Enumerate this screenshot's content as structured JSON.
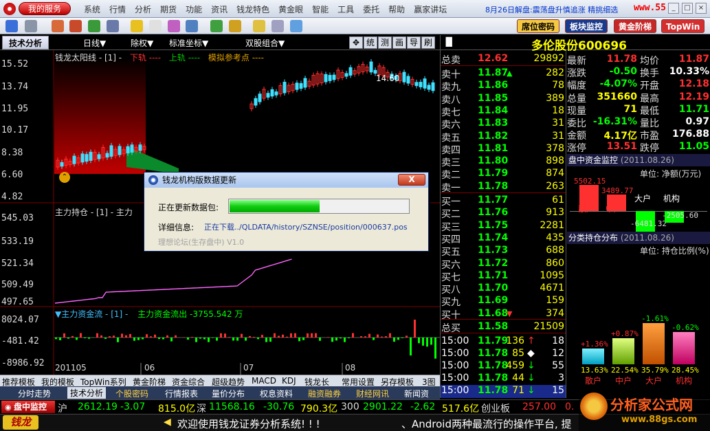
{
  "menubar": {
    "logo_label": "我的服务",
    "items": [
      "系统",
      "行情",
      "分析",
      "期货",
      "功能",
      "资讯",
      "钱龙特色",
      "黄金眼",
      "智能",
      "工具",
      "委托",
      "帮助",
      "赢家讲坛"
    ],
    "news": "8月26日解盘:震荡盘升慎追涨 精挑细选",
    "site": "www.55188.com",
    "win_min": "_",
    "win_max": "□",
    "win_close": "×"
  },
  "toolbar": {
    "buttons": [
      {
        "label": "席位密码",
        "color": "#f5c842",
        "text": "#000"
      },
      {
        "label": "板块监控",
        "color": "#1a3a8c",
        "text": "#fff"
      },
      {
        "label": "黄金阶梯",
        "color": "#c62828",
        "text": "#fff"
      },
      {
        "label": "TopWin",
        "color": "#d32f2f",
        "text": "#fff"
      }
    ]
  },
  "tabrow": {
    "tech_tab": "技术分析",
    "dropdowns": [
      "日线▼",
      "除权▼",
      "标准坐标▼",
      "双股组合▼"
    ],
    "tools": [
      "✥",
      "统",
      "测",
      "画",
      "导",
      "刷"
    ]
  },
  "chart": {
    "price_axis": [
      "15.52",
      "13.74",
      "11.95",
      "10.17",
      "8.38",
      "6.60",
      "4.82"
    ],
    "hold_axis": [
      "545.03",
      "533.19",
      "521.34",
      "509.49",
      "497.65"
    ],
    "flow_axis": [
      "8024.07",
      "-481.42",
      "-8986.92"
    ],
    "main_title": "钱龙太阳线 - [1] -",
    "legend_lower": "下轨 ----",
    "legend_upper": "上轨 ----",
    "legend_ref": "模拟参考点 ----",
    "peak_label": "14.60",
    "hold_title": "主力持仓 - [1] - 主力",
    "flow_title": "▼主力资金流 - [1] -",
    "flow_value": "主力资金流出 -3755.542 万",
    "date_labels": [
      "201105",
      "06",
      "07",
      "08"
    ]
  },
  "stock": {
    "tag": "▐▌",
    "name": "多伦股份600696"
  },
  "orderbook": {
    "sell_total": {
      "label": "总卖",
      "price": "12.62",
      "vol": "29892"
    },
    "sells": [
      {
        "label": "卖十",
        "price": "11.87",
        "vol": "282",
        "mark": "▲"
      },
      {
        "label": "卖九",
        "price": "11.86",
        "vol": "78",
        "mark": ""
      },
      {
        "label": "卖八",
        "price": "11.85",
        "vol": "389",
        "mark": ""
      },
      {
        "label": "卖七",
        "price": "11.84",
        "vol": "18",
        "mark": ""
      },
      {
        "label": "卖六",
        "price": "11.83",
        "vol": "31",
        "mark": ""
      },
      {
        "label": "卖五",
        "price": "11.82",
        "vol": "31",
        "mark": ""
      },
      {
        "label": "卖四",
        "price": "11.81",
        "vol": "378",
        "mark": ""
      },
      {
        "label": "卖三",
        "price": "11.80",
        "vol": "898",
        "mark": ""
      },
      {
        "label": "卖二",
        "price": "11.79",
        "vol": "874",
        "mark": ""
      },
      {
        "label": "卖一",
        "price": "11.78",
        "vol": "263",
        "mark": ""
      }
    ],
    "buys": [
      {
        "label": "买一",
        "price": "11.77",
        "vol": "61",
        "mark": ""
      },
      {
        "label": "买二",
        "price": "11.76",
        "vol": "913",
        "mark": ""
      },
      {
        "label": "买三",
        "price": "11.75",
        "vol": "2281",
        "mark": ""
      },
      {
        "label": "买四",
        "price": "11.74",
        "vol": "435",
        "mark": ""
      },
      {
        "label": "买五",
        "price": "11.73",
        "vol": "688",
        "mark": ""
      },
      {
        "label": "买六",
        "price": "11.72",
        "vol": "860",
        "mark": ""
      },
      {
        "label": "买七",
        "price": "11.71",
        "vol": "1095",
        "mark": ""
      },
      {
        "label": "买八",
        "price": "11.70",
        "vol": "4671",
        "mark": ""
      },
      {
        "label": "买九",
        "price": "11.69",
        "vol": "159",
        "mark": ""
      },
      {
        "label": "买十",
        "price": "11.68",
        "vol": "374",
        "mark": "▼"
      }
    ],
    "buy_total": {
      "label": "总买",
      "price": "11.58",
      "vol": "21509"
    },
    "ticks": [
      {
        "time": "15:00",
        "price": "11.79",
        "vol": "136",
        "arrow": "↑",
        "n": "18",
        "c": "#ff3030"
      },
      {
        "time": "15:00",
        "price": "11.78",
        "vol": "85",
        "arrow": "◆",
        "n": "12",
        "c": "#ffffff"
      },
      {
        "time": "15:00",
        "price": "11.78",
        "vol": "459",
        "arrow": "↓",
        "n": "55",
        "c": "#00ff00"
      },
      {
        "time": "15:00",
        "price": "11.78",
        "vol": "44",
        "arrow": "↓",
        "n": "3",
        "c": "#00ff00"
      },
      {
        "time": "15:00",
        "price": "11.78",
        "vol": "71",
        "arrow": "↓",
        "n": "15",
        "c": "#00ff00"
      }
    ]
  },
  "quote": [
    {
      "k1": "最新",
      "v1": "11.78",
      "c1": "#ff3030",
      "k2": "均价",
      "v2": "11.87",
      "c2": "#ff3030"
    },
    {
      "k1": "涨跌",
      "v1": "-0.50",
      "c1": "#00ff00",
      "k2": "换手",
      "v2": "10.33%",
      "c2": "#ffffff"
    },
    {
      "k1": "幅度",
      "v1": "-4.07%",
      "c1": "#00ff00",
      "k2": "开盘",
      "v2": "12.18",
      "c2": "#ff3030"
    },
    {
      "k1": "总量",
      "v1": "351660",
      "c1": "#ffff00",
      "k2": "最高",
      "v2": "12.19",
      "c2": "#ff3030"
    },
    {
      "k1": "现量",
      "v1": "71",
      "c1": "#ffff00",
      "k2": "最低",
      "v2": "11.71",
      "c2": "#00ff00"
    },
    {
      "k1": "委比",
      "v1": "-16.31%",
      "c1": "#00ff00",
      "k2": "量比",
      "v2": "0.97",
      "c2": "#ffffff"
    },
    {
      "k1": "金额",
      "v1": "4.17亿",
      "c1": "#ffff00",
      "k2": "市盈",
      "v2": "176.88",
      "c2": "#ffffff"
    },
    {
      "k1": "涨停",
      "v1": "13.51",
      "c1": "#ff3030",
      "k2": "跌停",
      "v2": "11.05",
      "c2": "#00ff00"
    }
  ],
  "fund_monitor": {
    "title": "盘中资金监控",
    "date": "(2011.08.26)",
    "unit": "单位: 净额(万元)",
    "bars": [
      {
        "name": "散户",
        "label": "5502.15",
        "value": 5502.15
      },
      {
        "name": "中户",
        "label": "3489.77",
        "value": 3489.77
      },
      {
        "name": "大户",
        "label": "-6481.32",
        "value": -6481.32
      },
      {
        "name": "机构",
        "label": "-2505.60",
        "value": -2505.6
      }
    ]
  },
  "holding_dist": {
    "title": "分类持仓分布",
    "date": "(2011.08.26)",
    "unit": "单位: 持仓比例(%)",
    "bars": [
      {
        "name": "散户",
        "pct": "13.63%",
        "chg": "+1.36%",
        "value": 13.63
      },
      {
        "name": "中户",
        "pct": "22.54%",
        "chg": "+0.87%",
        "value": 22.54
      },
      {
        "name": "大户",
        "pct": "35.79%",
        "chg": "-1.61%",
        "value": 35.79
      },
      {
        "name": "机构",
        "pct": "28.45%",
        "chg": "-0.62%",
        "value": 28.45
      }
    ]
  },
  "tabs1": [
    "推荐模板",
    "我的模板",
    "TopWin系列",
    "黄金阶梯",
    "资金综合",
    "超级趋势",
    "MACD",
    "KDJ",
    "钱龙长",
    "常用设置",
    "另存模板",
    "3图"
  ],
  "tabs2": [
    "分时走势",
    "技术分析",
    "个股密码",
    "行情报表",
    "量价分布",
    "权息资料",
    "融资融券",
    "财经网讯",
    "新闻资"
  ],
  "ticker1": {
    "label": "盘中监控",
    "sh_name": "沪",
    "sh_index": "2612.19",
    "sh_chg": "-3.07",
    "sh_amt": "815.0亿",
    "sz_name": "深",
    "sz_index": "11568.16",
    "sz_chg": "-30.76",
    "sz_amt": "790.3亿",
    "c300_name": "300",
    "c300_index": "2901.22",
    "c300_chg": "-2.62",
    "c300_amt": "517.6亿",
    "cy_name": "创业板",
    "cy_index": "257.00",
    "cy_chg": "0."
  },
  "ticker2": {
    "brand": "钱龙",
    "welcome": "欢迎使用钱龙证券分析系统! ! !",
    "news": "、Android两种最流行的操作平台, 提"
  },
  "watermark": {
    "name": "分析家公式网",
    "url": "www.88gs.com"
  },
  "dialog": {
    "title": "钱龙机构版数据更新",
    "close": "X",
    "status_label": "正在更新数据包:",
    "detail_label": "详细信息:",
    "detail_value": "正在下载../QLDATA/history/SZNSE/position/000637.pos",
    "footer": "理想论坛(生存盘中) V1.0",
    "progress": 0.5
  },
  "colors": {
    "up": "#ff3030",
    "down": "#00ff00",
    "accent": "#ffff00",
    "panel_head": "#1a1a40"
  }
}
